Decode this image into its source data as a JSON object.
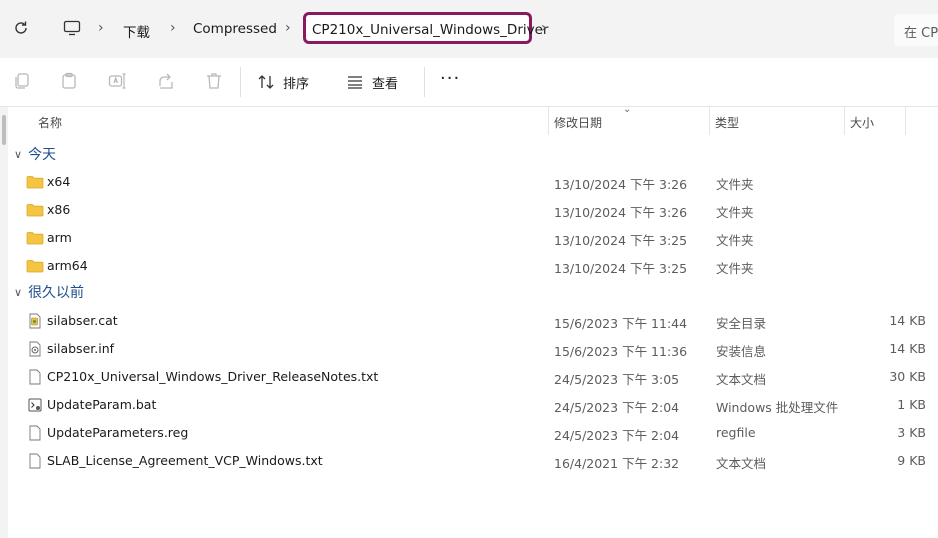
{
  "address": {
    "segments": [
      "下载",
      "Compressed"
    ],
    "current": "CP210x_Universal_Windows_Driver",
    "search_placeholder": "在 CP"
  },
  "toolbar": {
    "sort_label": "排序",
    "view_label": "查看",
    "more_label": "···"
  },
  "columns": {
    "name": "名称",
    "date": "修改日期",
    "type": "类型",
    "size": "大小"
  },
  "groups": [
    {
      "label": "今天",
      "items": [
        {
          "name": "x64",
          "date": "13/10/2024 下午 3:26",
          "type": "文件夹",
          "size": "",
          "icon": "folder-icon"
        },
        {
          "name": "x86",
          "date": "13/10/2024 下午 3:26",
          "type": "文件夹",
          "size": "",
          "icon": "folder-icon"
        },
        {
          "name": "arm",
          "date": "13/10/2024 下午 3:25",
          "type": "文件夹",
          "size": "",
          "icon": "folder-icon"
        },
        {
          "name": "arm64",
          "date": "13/10/2024 下午 3:25",
          "type": "文件夹",
          "size": "",
          "icon": "folder-icon"
        }
      ]
    },
    {
      "label": "很久以前",
      "items": [
        {
          "name": "silabser.cat",
          "date": "15/6/2023 下午 11:44",
          "type": "安全目录",
          "size": "14 KB",
          "icon": "security-catalog-icon"
        },
        {
          "name": "silabser.inf",
          "date": "15/6/2023 下午 11:36",
          "type": "安装信息",
          "size": "14 KB",
          "icon": "setup-info-icon"
        },
        {
          "name": "CP210x_Universal_Windows_Driver_ReleaseNotes.txt",
          "date": "24/5/2023 下午 3:05",
          "type": "文本文档",
          "size": "30 KB",
          "icon": "text-file-icon"
        },
        {
          "name": "UpdateParam.bat",
          "date": "24/5/2023 下午 2:04",
          "type": "Windows 批处理文件",
          "size": "1 KB",
          "icon": "batch-file-icon"
        },
        {
          "name": "UpdateParameters.reg",
          "date": "24/5/2023 下午 2:04",
          "type": "regfile",
          "size": "3 KB",
          "icon": "registry-file-icon"
        },
        {
          "name": "SLAB_License_Agreement_VCP_Windows.txt",
          "date": "16/4/2021 下午 2:32",
          "type": "文本文档",
          "size": "9 KB",
          "icon": "text-file-icon"
        }
      ]
    }
  ],
  "colors": {
    "highlight_border": "#8a1a5f",
    "group_header": "#1f4e8c",
    "folder": "#f4c542"
  }
}
